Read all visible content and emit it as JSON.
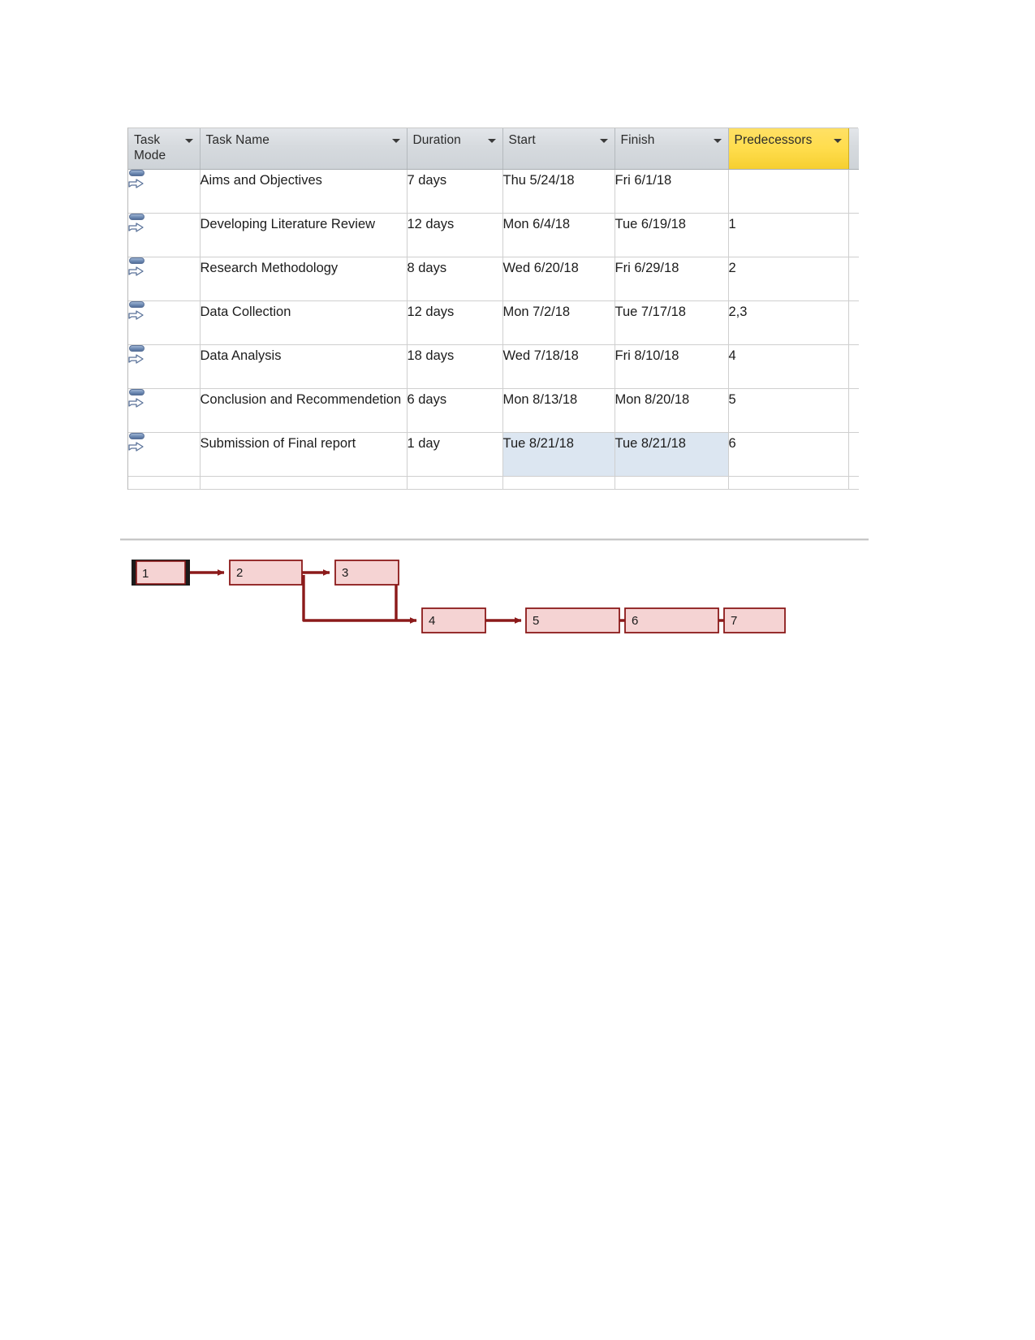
{
  "table": {
    "columns": [
      {
        "key": "task_mode",
        "label": "Task Mode",
        "highlighted": false
      },
      {
        "key": "task_name",
        "label": "Task Name",
        "highlighted": false
      },
      {
        "key": "duration",
        "label": "Duration",
        "highlighted": false
      },
      {
        "key": "start",
        "label": "Start",
        "highlighted": false
      },
      {
        "key": "finish",
        "label": "Finish",
        "highlighted": false
      },
      {
        "key": "predecessors",
        "label": "Predecessors",
        "highlighted": true
      }
    ],
    "header_highlight_color": "#ffdd4d",
    "selection_color": "#dce6f1",
    "filter_icon": "filter-dropdown-arrow-icon",
    "mode_icon": "manually-scheduled-task-icon",
    "rows": [
      {
        "task_mode": "manually-scheduled-task-icon",
        "task_name": "Aims and Objectives",
        "duration": "7 days",
        "start": "Thu 5/24/18",
        "finish": "Fri 6/1/18",
        "predecessors": "",
        "selected": false
      },
      {
        "task_mode": "manually-scheduled-task-icon",
        "task_name": "Developing Literature Review",
        "duration": "12 days",
        "start": "Mon 6/4/18",
        "finish": "Tue 6/19/18",
        "predecessors": "1",
        "selected": false
      },
      {
        "task_mode": "manually-scheduled-task-icon",
        "task_name": "Research Methodology",
        "duration": "8 days",
        "start": "Wed 6/20/18",
        "finish": "Fri 6/29/18",
        "predecessors": "2",
        "selected": false
      },
      {
        "task_mode": "manually-scheduled-task-icon",
        "task_name": "Data Collection",
        "duration": "12 days",
        "start": "Mon 7/2/18",
        "finish": "Tue 7/17/18",
        "predecessors": "2,3",
        "selected": false
      },
      {
        "task_mode": "manually-scheduled-task-icon",
        "task_name": "Data Analysis",
        "duration": "18 days",
        "start": "Wed 7/18/18",
        "finish": "Fri 8/10/18",
        "predecessors": "4",
        "selected": false
      },
      {
        "task_mode": "manually-scheduled-task-icon",
        "task_name": "Conclusion and Recommendetion",
        "duration": "6 days",
        "start": "Mon 8/13/18",
        "finish": "Mon 8/20/18",
        "predecessors": "5",
        "selected": false
      },
      {
        "task_mode": "manually-scheduled-task-icon",
        "task_name": "Submission of Final report",
        "duration": "1 day",
        "start": "Tue 8/21/18",
        "finish": "Tue 8/21/18",
        "predecessors": "6",
        "selected": true
      }
    ]
  },
  "network_diagram": {
    "node_fill": "#f5d3d3",
    "node_border": "#8b1a1a",
    "link_color": "#8b1a1a",
    "selection_border": "#1b1b1b",
    "nodes": [
      {
        "id": "1",
        "label": "1",
        "selected": true
      },
      {
        "id": "2",
        "label": "2",
        "selected": false
      },
      {
        "id": "3",
        "label": "3",
        "selected": false
      },
      {
        "id": "4",
        "label": "4",
        "selected": false
      },
      {
        "id": "5",
        "label": "5",
        "selected": false
      },
      {
        "id": "6",
        "label": "6",
        "selected": false
      },
      {
        "id": "7",
        "label": "7",
        "selected": false
      }
    ],
    "links": [
      {
        "from": "1",
        "to": "2"
      },
      {
        "from": "2",
        "to": "3"
      },
      {
        "from": "2",
        "to": "4"
      },
      {
        "from": "3",
        "to": "4"
      },
      {
        "from": "4",
        "to": "5"
      },
      {
        "from": "5",
        "to": "6"
      },
      {
        "from": "6",
        "to": "7"
      }
    ]
  }
}
